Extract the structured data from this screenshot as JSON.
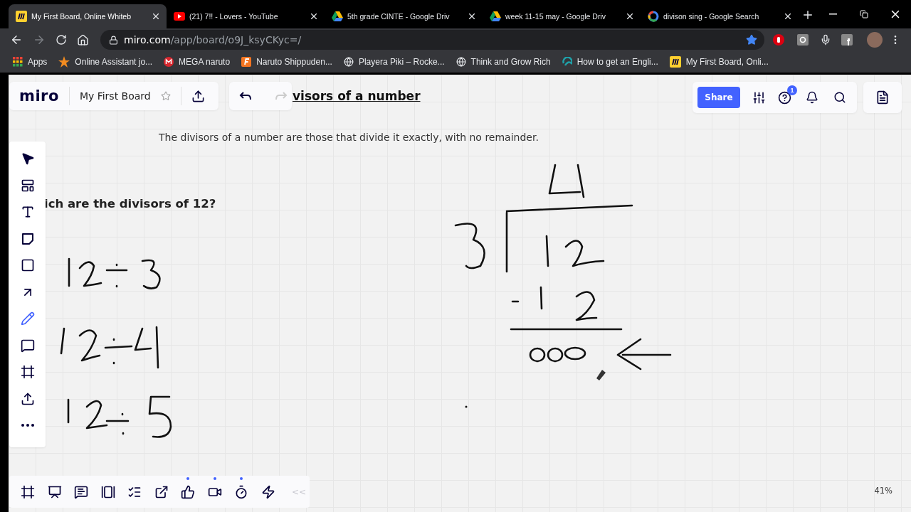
{
  "browser": {
    "tabs": [
      {
        "kind": "miro",
        "title": "My First Board, Online Whiteb",
        "selected": true
      },
      {
        "kind": "youtube",
        "title": "(21) 7!! - Lovers - YouTube",
        "selected": false
      },
      {
        "kind": "drive",
        "title": "5th grade CINTE - Google Driv",
        "selected": false
      },
      {
        "kind": "drive",
        "title": "week 11-15 may - Google Driv",
        "selected": false
      },
      {
        "kind": "google",
        "title": "divison sing - Google Search",
        "selected": false
      }
    ],
    "address": {
      "host": "miro.com",
      "path": "/app/board/o9J_ksyCKyc=/"
    },
    "bookmarks": [
      {
        "kind": "apps",
        "label": "Apps"
      },
      {
        "kind": "star",
        "label": "Online Assistant jo..."
      },
      {
        "kind": "mega",
        "label": "MEGA naruto"
      },
      {
        "kind": "square",
        "label": "Naruto Shippuden..."
      },
      {
        "kind": "globe",
        "label": "Playera Piki – Rocke..."
      },
      {
        "kind": "globe",
        "label": "Think and Grow Rich"
      },
      {
        "kind": "swirl",
        "label": "How to get an Engli..."
      },
      {
        "kind": "miro",
        "label": "My First Board, Onli..."
      }
    ]
  },
  "board": {
    "logo": "miro",
    "name": "My First Board",
    "heading": "visors of a number",
    "subtitle": "The divisors of a number are those that divide it exactly, with no remainder.",
    "question": "ich are the divisors of 12?",
    "share": "Share",
    "help_badge": "1",
    "tools": [
      {
        "kind": "select",
        "selected": false
      },
      {
        "kind": "templates",
        "selected": false
      },
      {
        "kind": "text",
        "selected": false
      },
      {
        "kind": "note",
        "selected": false
      },
      {
        "kind": "shape",
        "selected": false
      },
      {
        "kind": "arrow",
        "selected": false
      },
      {
        "kind": "pen",
        "selected": true
      },
      {
        "kind": "comment",
        "selected": false
      },
      {
        "kind": "frame",
        "selected": false
      },
      {
        "kind": "upload",
        "selected": false
      },
      {
        "kind": "more",
        "selected": false
      }
    ],
    "bottom_tools": [
      {
        "kind": "frames",
        "indicator": false
      },
      {
        "kind": "present",
        "indicator": false
      },
      {
        "kind": "chat",
        "indicator": false
      },
      {
        "kind": "cards",
        "indicator": false
      },
      {
        "kind": "list",
        "indicator": false
      },
      {
        "kind": "share",
        "indicator": false
      },
      {
        "kind": "vote",
        "indicator": true
      },
      {
        "kind": "video",
        "indicator": true
      },
      {
        "kind": "timer",
        "indicator": true
      },
      {
        "kind": "power",
        "indicator": false
      }
    ],
    "collapse": "<<",
    "zoom": "41%"
  }
}
